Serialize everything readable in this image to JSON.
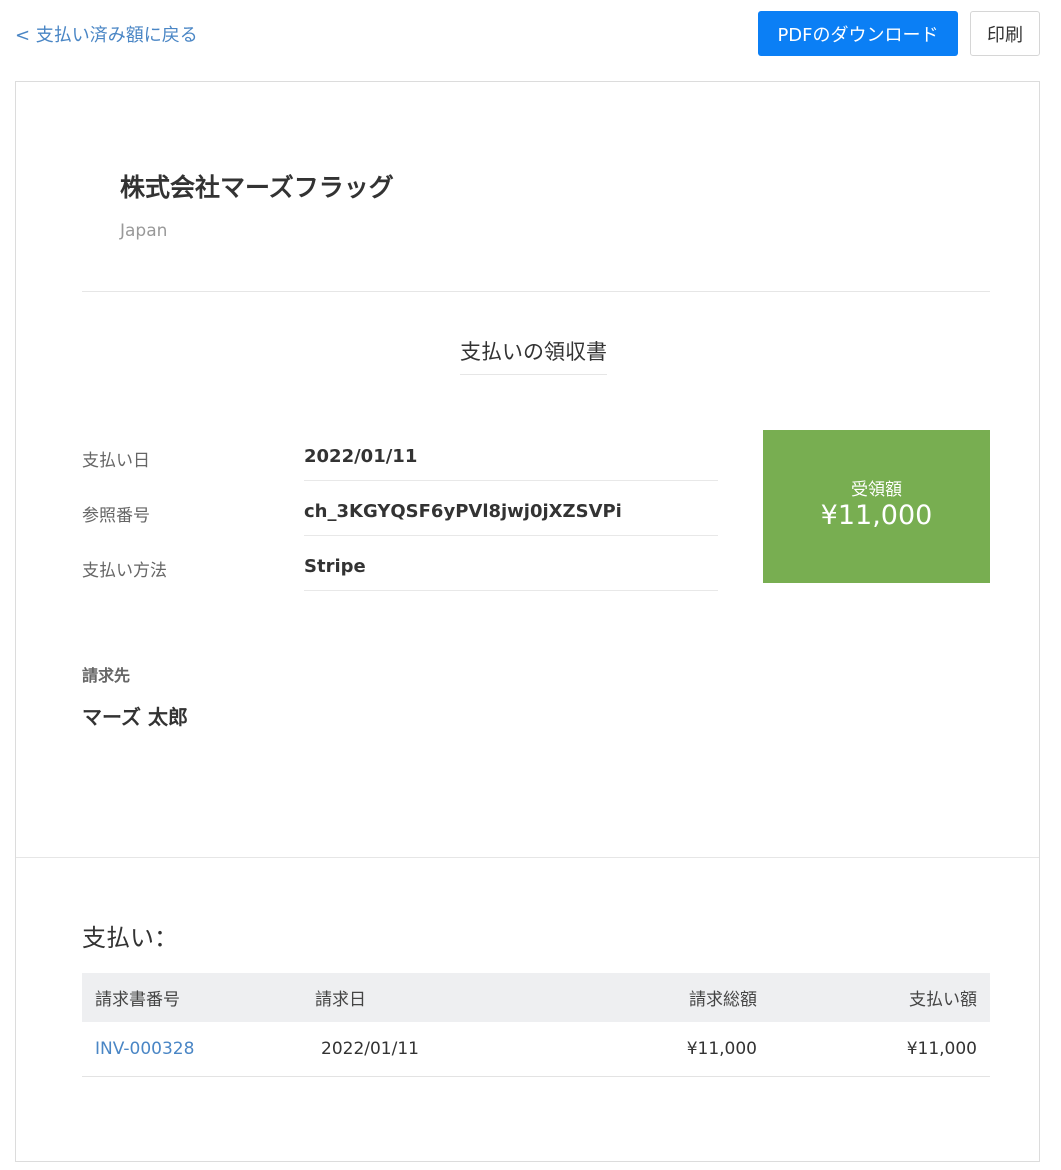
{
  "topbar": {
    "back_label": "< 支払い済み額に戻る",
    "pdf_button_label": "PDFのダウンロード",
    "print_button_label": "印刷"
  },
  "company": {
    "name": "株式会社マーズフラッグ",
    "country": "Japan"
  },
  "receipt": {
    "title": "支払いの領収書",
    "details": [
      {
        "label": "支払い日",
        "value": "2022/01/11"
      },
      {
        "label": "参照番号",
        "value": "ch_3KGYQSF6yPVl8jwj0jXZSVPi"
      },
      {
        "label": "支払い方法",
        "value": "Stripe"
      }
    ],
    "amount_label": "受領額",
    "amount_value": "¥11,000",
    "bill_to_label": "請求先",
    "bill_to_name": "マーズ 太郎"
  },
  "payments": {
    "heading": "支払い：",
    "columns": [
      "請求書番号",
      "請求日",
      "請求総額",
      "支払い額"
    ],
    "rows": [
      {
        "invoice_number": "INV-000328",
        "invoice_date": "2022/01/11",
        "invoice_total": "¥11,000",
        "amount_paid": "¥11,000"
      }
    ]
  },
  "colors": {
    "link": "#4a86c5",
    "primary_button": "#0b7ff5",
    "amount_box": "#78ae51"
  }
}
